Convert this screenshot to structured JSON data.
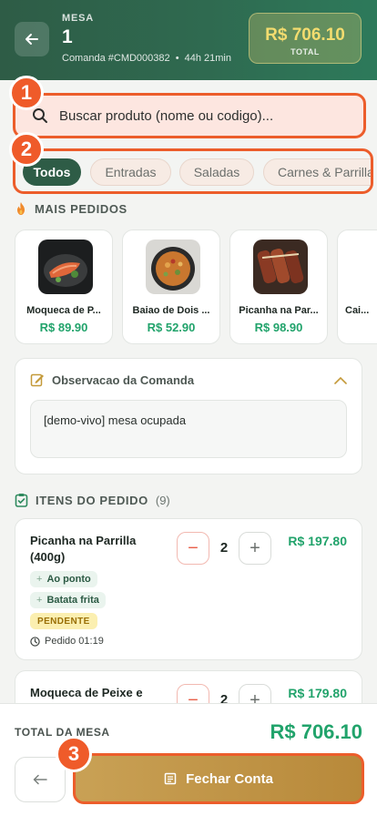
{
  "header": {
    "mesa_label": "MESA",
    "mesa_number": "1",
    "comanda": "Comanda #CMD000382",
    "separator": "•",
    "elapsed": "44h 21min",
    "total_value": "R$ 706.10",
    "total_label": "TOTAL"
  },
  "search": {
    "placeholder": "Buscar produto (nome ou codigo)..."
  },
  "categories": [
    {
      "label": "Todos",
      "active": true
    },
    {
      "label": "Entradas",
      "active": false
    },
    {
      "label": "Saladas",
      "active": false
    },
    {
      "label": "Carnes & Parrilla",
      "active": false
    }
  ],
  "badges": [
    "1",
    "2",
    "3"
  ],
  "popular": {
    "title": "MAIS PEDIDOS",
    "items": [
      {
        "name": "Moqueca de P...",
        "price": "R$ 89.90"
      },
      {
        "name": "Baiao de Dois ...",
        "price": "R$ 52.90"
      },
      {
        "name": "Picanha na Par...",
        "price": "R$ 98.90"
      },
      {
        "name": "Cai...",
        "price": ""
      }
    ]
  },
  "observation": {
    "title": "Observacao da Comanda",
    "text": "[demo-vivo] mesa ocupada"
  },
  "order": {
    "title": "ITENS DO PEDIDO",
    "count": "(9)",
    "items": [
      {
        "name": "Picanha na Parrilla (400g)",
        "qty": "2",
        "price": "R$ 197.80",
        "mods": [
          "Ao ponto",
          "Batata frita"
        ],
        "status": "PENDENTE",
        "ordered": "Pedido 01:19"
      },
      {
        "name": "Moqueca de Peixe e",
        "qty": "2",
        "price": "R$ 179.80"
      }
    ]
  },
  "footer": {
    "total_label": "TOTAL DA MESA",
    "total_value": "R$ 706.10",
    "close_label": "Fechar Conta"
  },
  "colors": {
    "header": "#2e5c46",
    "accent_green": "#21a36b",
    "highlight": "#ec5d2b",
    "gold": "#c9a155"
  }
}
